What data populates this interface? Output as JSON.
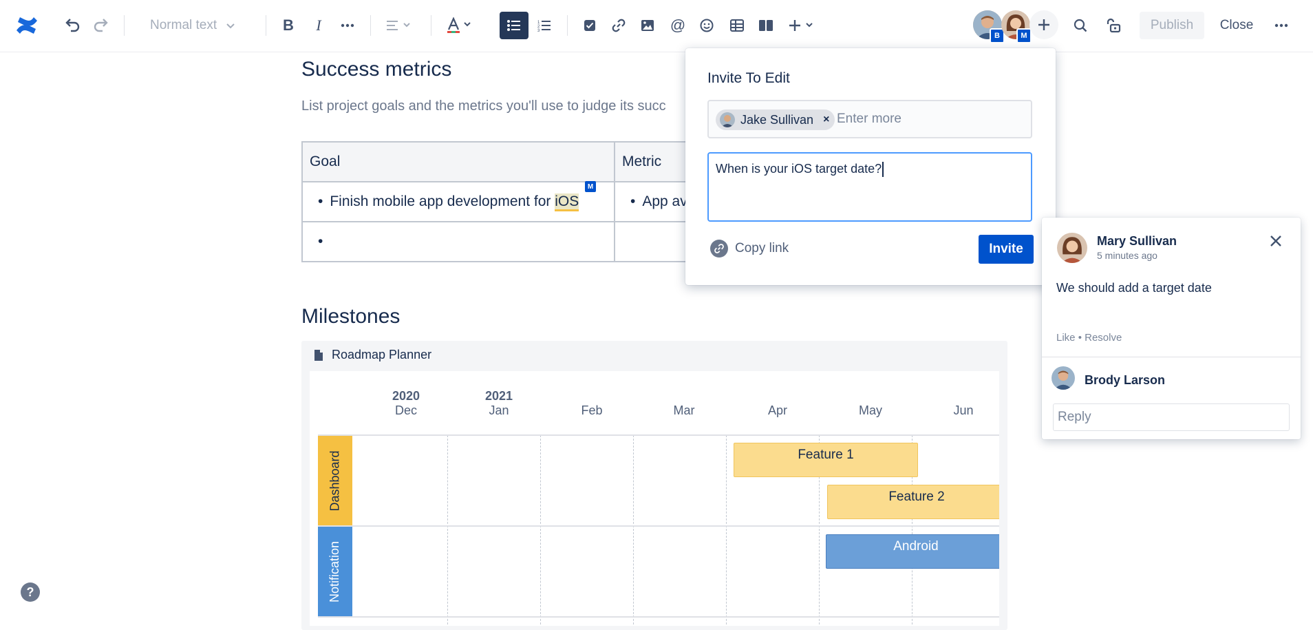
{
  "toolbar": {
    "text_style": "Normal text",
    "publish_label": "Publish",
    "close_label": "Close",
    "collaborators": [
      {
        "initial": "B"
      },
      {
        "initial": "M"
      }
    ]
  },
  "page": {
    "success_heading": "Success metrics",
    "success_desc": "List project goals and the metrics you'll use to judge its succ",
    "table": {
      "headers": [
        "Goal",
        "Metric"
      ],
      "row1_goal_prefix": "Finish mobile app development for ",
      "row1_goal_highlight": "iOS",
      "row1_metric": "App av",
      "highlight_badge": "M"
    },
    "milestones_heading": "Milestones"
  },
  "roadmap": {
    "title": "Roadmap Planner",
    "years": [
      "2020",
      "2021"
    ],
    "months": [
      "Dec",
      "Jan",
      "Feb",
      "Mar",
      "Apr",
      "May",
      "Jun"
    ],
    "lanes": [
      {
        "label": "Dashboard",
        "color": "#f5c042"
      },
      {
        "label": "Notification",
        "color": "#4a90d9"
      }
    ],
    "bars": [
      {
        "label": "Feature 1",
        "color": "#fbdc8e"
      },
      {
        "label": "Feature 2",
        "color": "#fbdc8e"
      },
      {
        "label": "Android",
        "color": "#6b9fd8"
      }
    ]
  },
  "invite": {
    "title": "Invite To Edit",
    "chip_name": "Jake Sullivan",
    "more_placeholder": "Enter more",
    "message": "When is your iOS target date?",
    "copy_link": "Copy link",
    "invite_label": "Invite"
  },
  "comment": {
    "author": "Mary Sullivan",
    "time": "5 minutes ago",
    "body": "We should add a target date",
    "like": "Like",
    "resolve": "Resolve",
    "replier": "Brody Larson",
    "reply_placeholder": "Reply"
  },
  "colors": {
    "accent": "#0052cc",
    "toolbar_active": "#253858"
  }
}
